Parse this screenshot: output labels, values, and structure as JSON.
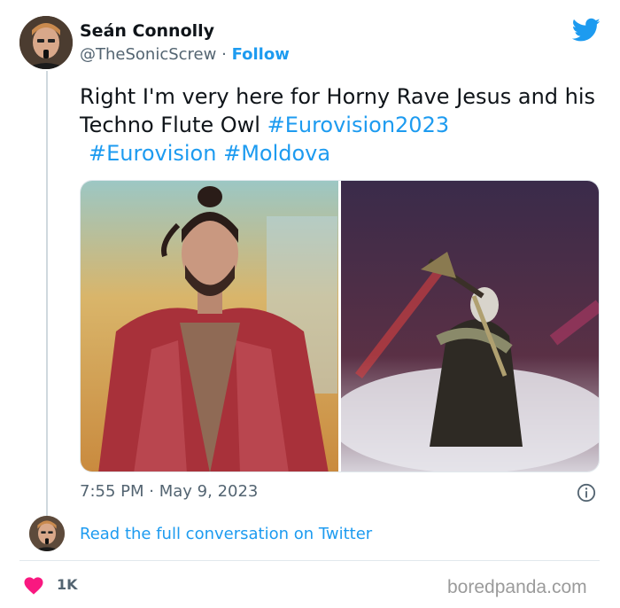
{
  "author": {
    "name": "Seán Connolly",
    "handle": "@TheSonicScrew",
    "separator": "·",
    "follow_label": "Follow"
  },
  "tweet": {
    "text_plain": "Right I'm very here for Horny Rave Jesus and his Techno Flute Owl ",
    "hashtags": [
      "#Eurovision2023",
      "#Eurovision",
      "#Moldova"
    ],
    "time": "7:55 PM",
    "separator": "·",
    "date": "May 9, 2023"
  },
  "footer": {
    "read_more": "Read the full conversation on Twitter",
    "like_count": "1K"
  },
  "watermark": "boredpanda.com",
  "icons": {
    "brand": "twitter-bird-icon",
    "info": "info-icon",
    "like": "heart-icon"
  },
  "colors": {
    "accent": "#1d9bf0",
    "muted": "#536471",
    "heart": "#f91880"
  }
}
